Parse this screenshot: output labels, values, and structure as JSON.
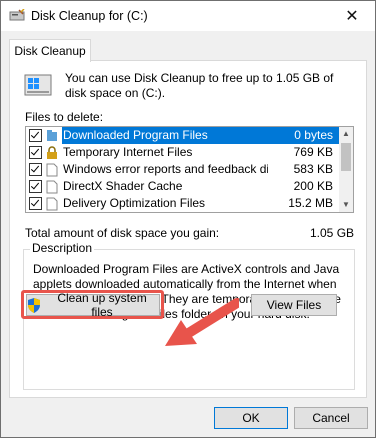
{
  "window": {
    "title": "Disk Cleanup for  (C:)",
    "close_glyph": "✕"
  },
  "tab": {
    "label": "Disk Cleanup"
  },
  "intro": "You can use Disk Cleanup to free up to 1.05 GB of disk space on  (C:).",
  "files_to_delete_label": "Files to delete:",
  "files": [
    {
      "name": "Downloaded Program Files",
      "size": "0 bytes",
      "checked": true,
      "selected": true,
      "icon": "folder-icon"
    },
    {
      "name": "Temporary Internet Files",
      "size": "769 KB",
      "checked": true,
      "selected": false,
      "icon": "lock-icon"
    },
    {
      "name": "Windows error reports and feedback dia...",
      "size": "583 KB",
      "checked": true,
      "selected": false,
      "icon": "document-icon"
    },
    {
      "name": "DirectX Shader Cache",
      "size": "200 KB",
      "checked": true,
      "selected": false,
      "icon": "document-icon"
    },
    {
      "name": "Delivery Optimization Files",
      "size": "15.2 MB",
      "checked": true,
      "selected": false,
      "icon": "document-icon"
    }
  ],
  "total": {
    "label": "Total amount of disk space you gain:",
    "value": "1.05 GB"
  },
  "description": {
    "legend": "Description",
    "text": "Downloaded Program Files are ActiveX controls and Java applets downloaded automatically from the Internet when you view certain pages. They are temporarily stored in the Downloaded Program Files folder on your hard disk."
  },
  "buttons": {
    "cleanup": "Clean up system files",
    "view_files": "View Files",
    "ok": "OK",
    "cancel": "Cancel"
  },
  "colors": {
    "selection": "#0078d7",
    "annotation_red": "#e8544b"
  }
}
